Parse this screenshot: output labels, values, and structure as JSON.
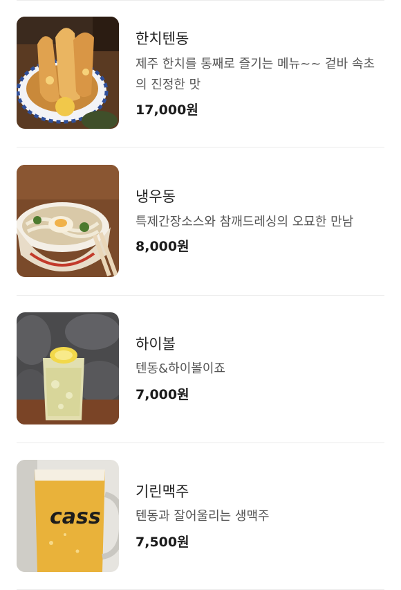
{
  "menu": {
    "items": [
      {
        "name": "한치텐동",
        "description": "제주 한치를 통째로 즐기는 메뉴~~ 겉바 속초의 진정한 맛",
        "price": "17,000원",
        "image_icon": "tendon-photo"
      },
      {
        "name": "냉우동",
        "description": "특제간장소스와 참깨드레싱의 오묘한 만남",
        "price": "8,000원",
        "image_icon": "cold-udon-photo"
      },
      {
        "name": "하이볼",
        "description": "텐동&하이볼이죠",
        "price": "7,000원",
        "image_icon": "highball-photo"
      },
      {
        "name": "기린맥주",
        "description": "텐동과 잘어울리는 생맥주",
        "price": "7,500원",
        "image_icon": "beer-photo"
      }
    ]
  },
  "colors": {
    "divider": "#ececec",
    "name_text": "#222222",
    "desc_text": "#555555",
    "price_text": "#1a1a1a"
  }
}
